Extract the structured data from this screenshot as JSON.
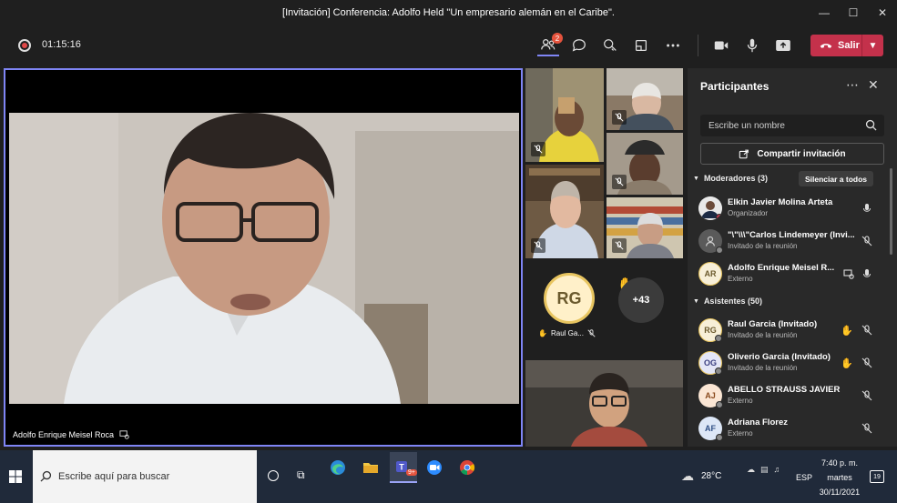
{
  "window": {
    "title": "[Invitación] Conferencia: Adolfo Held \"Un empresario alemán en el Caribe\"."
  },
  "toolbar": {
    "timer": "01:15:16",
    "people_badge": "2",
    "leave_label": "Salir"
  },
  "stage": {
    "speaker_name": "Adolfo Enrique Meisel Roca"
  },
  "tiles": {
    "rg_initials": "RG",
    "rg_name": "Raul Ga...",
    "more_count": "+43"
  },
  "panel": {
    "title": "Participantes",
    "search_placeholder": "Escribe un nombre",
    "share_label": "Compartir invitación",
    "moderators_label": "Moderadores (3)",
    "mute_all_label": "Silenciar a todos",
    "attendees_label": "Asistentes (50)",
    "moderators": [
      {
        "initials": "",
        "name": "Elkin Javier Molina Arteta",
        "role": "Organizador"
      },
      {
        "initials": "",
        "name": "\"\\\"\\\\\\\"Carlos Lindemeyer (Invi...",
        "role": "Invitado de la reunión"
      },
      {
        "initials": "AR",
        "name": "Adolfo Enrique Meisel R...",
        "role": "Externo"
      }
    ],
    "attendees": [
      {
        "initials": "RG",
        "name": "Raul Garcia (Invitado)",
        "role": "Invitado de la reunión"
      },
      {
        "initials": "OG",
        "name": "Oliverio Garcia (Invitado)",
        "role": "Invitado de la reunión"
      },
      {
        "initials": "AJ",
        "name": "ABELLO STRAUSS JAVIER",
        "role": "Externo"
      },
      {
        "initials": "AF",
        "name": "Adriana Florez",
        "role": "Externo"
      }
    ]
  },
  "taskbar": {
    "search_placeholder": "Escribe aquí para buscar",
    "teams_badge": "9+",
    "weather": "28°C",
    "lang": "ESP",
    "time": "7:40 p. m.",
    "day": "martes",
    "date": "30/11/2021",
    "notifications": "19"
  },
  "colors": {
    "accent": "#7f85f5",
    "leave": "#c4314b",
    "raise_hand": "#f2c744"
  }
}
